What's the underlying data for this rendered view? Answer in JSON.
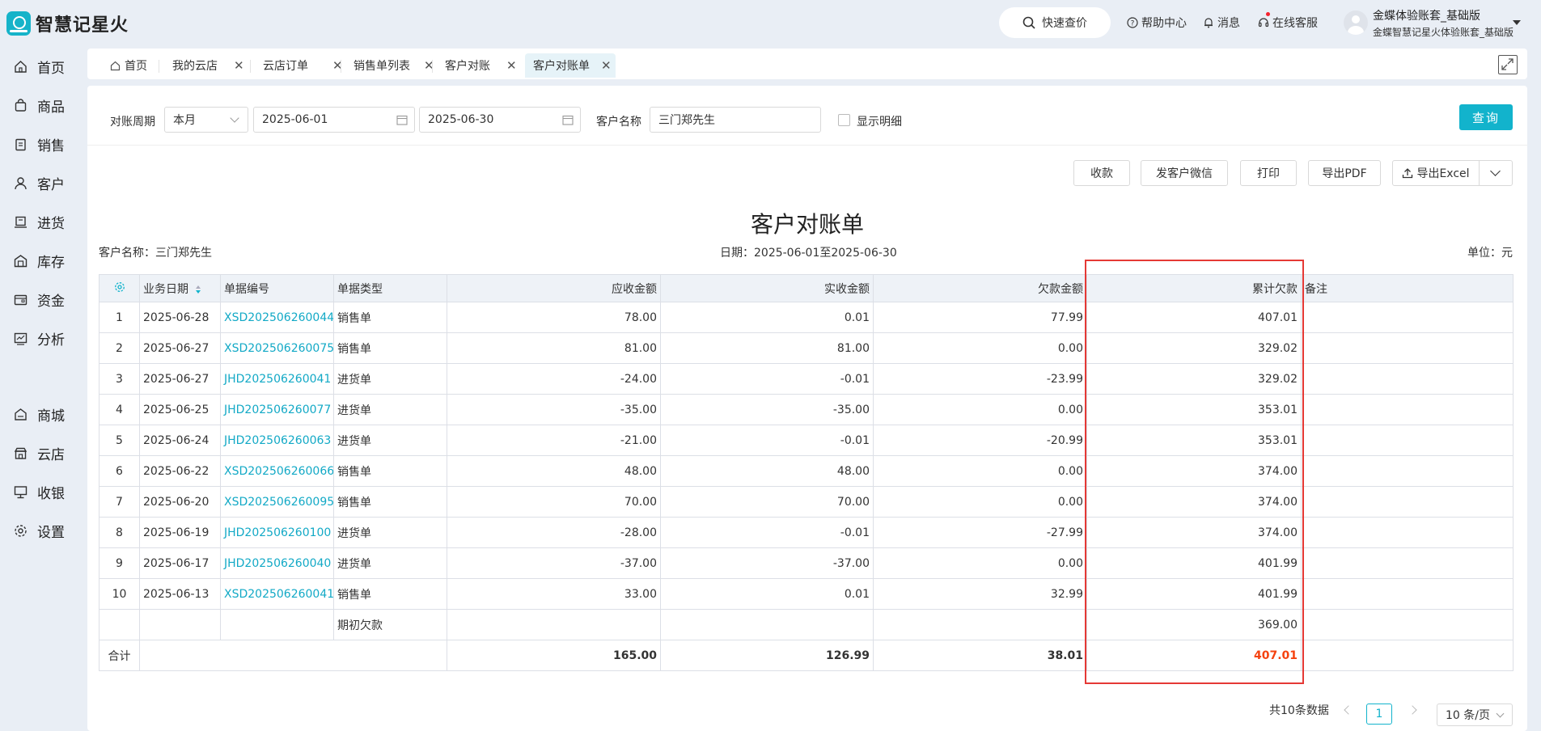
{
  "header": {
    "app_title": "智慧记星火",
    "quick_search": "快速查价",
    "help": "帮助中心",
    "messages": "消息",
    "support": "在线客服",
    "account_name": "金蝶体验账套_基础版",
    "account_sub": "金蝶智慧记星火体验账套_基础版"
  },
  "sidebar": {
    "items": [
      {
        "label": "首页",
        "icon": "home-icon"
      },
      {
        "label": "商品",
        "icon": "bag-icon"
      },
      {
        "label": "销售",
        "icon": "clipboard-icon"
      },
      {
        "label": "客户",
        "icon": "user-icon"
      },
      {
        "label": "进货",
        "icon": "truck-icon"
      },
      {
        "label": "库存",
        "icon": "warehouse-icon"
      },
      {
        "label": "资金",
        "icon": "wallet-icon"
      },
      {
        "label": "分析",
        "icon": "chart-icon"
      },
      {
        "label": "商城",
        "icon": "store-icon"
      },
      {
        "label": "云店",
        "icon": "cloud-store-icon"
      },
      {
        "label": "收银",
        "icon": "cashier-icon"
      },
      {
        "label": "设置",
        "icon": "gear-icon"
      }
    ]
  },
  "tabs": [
    {
      "label": "首页"
    },
    {
      "label": "我的云店"
    },
    {
      "label": "云店订单"
    },
    {
      "label": "销售单列表"
    },
    {
      "label": "客户对账"
    },
    {
      "label": "客户对账单"
    }
  ],
  "filter": {
    "period_label": "对账周期",
    "period_value": "本月",
    "start_date": "2025-06-01",
    "end_date": "2025-06-30",
    "customer_label": "客户名称",
    "customer_value": "三门郑先生",
    "show_detail": "显示明细",
    "query_button": "查询"
  },
  "actions": {
    "receive": "收款",
    "send_wechat": "发客户微信",
    "print": "打印",
    "export_pdf": "导出PDF",
    "export_excel": "导出Excel"
  },
  "report": {
    "title": "客户对账单",
    "customer_line": "客户名称：三门郑先生",
    "date_line": "日期：2025-06-01至2025-06-30",
    "unit_line": "单位：元"
  },
  "table": {
    "headers": {
      "date": "业务日期",
      "doc_no": "单据编号",
      "doc_type": "单据类型",
      "receivable": "应收金额",
      "received": "实收金额",
      "owed": "欠款金额",
      "cumulative": "累计欠款",
      "remark": "备注"
    },
    "rows": [
      {
        "no": "1",
        "date": "2025-06-28",
        "doc": "XSD202506260044",
        "type": "销售单",
        "receivable": "78.00",
        "received": "0.01",
        "owed": "77.99",
        "cumulative": "407.01"
      },
      {
        "no": "2",
        "date": "2025-06-27",
        "doc": "XSD202506260075",
        "type": "销售单",
        "receivable": "81.00",
        "received": "81.00",
        "owed": "0.00",
        "cumulative": "329.02"
      },
      {
        "no": "3",
        "date": "2025-06-27",
        "doc": "JHD202506260041",
        "type": "进货单",
        "receivable": "-24.00",
        "received": "-0.01",
        "owed": "-23.99",
        "cumulative": "329.02"
      },
      {
        "no": "4",
        "date": "2025-06-25",
        "doc": "JHD202506260077",
        "type": "进货单",
        "receivable": "-35.00",
        "received": "-35.00",
        "owed": "0.00",
        "cumulative": "353.01"
      },
      {
        "no": "5",
        "date": "2025-06-24",
        "doc": "JHD202506260063",
        "type": "进货单",
        "receivable": "-21.00",
        "received": "-0.01",
        "owed": "-20.99",
        "cumulative": "353.01"
      },
      {
        "no": "6",
        "date": "2025-06-22",
        "doc": "XSD202506260066",
        "type": "销售单",
        "receivable": "48.00",
        "received": "48.00",
        "owed": "0.00",
        "cumulative": "374.00"
      },
      {
        "no": "7",
        "date": "2025-06-20",
        "doc": "XSD202506260095",
        "type": "销售单",
        "receivable": "70.00",
        "received": "70.00",
        "owed": "0.00",
        "cumulative": "374.00"
      },
      {
        "no": "8",
        "date": "2025-06-19",
        "doc": "JHD202506260100",
        "type": "进货单",
        "receivable": "-28.00",
        "received": "-0.01",
        "owed": "-27.99",
        "cumulative": "374.00"
      },
      {
        "no": "9",
        "date": "2025-06-17",
        "doc": "JHD202506260040",
        "type": "进货单",
        "receivable": "-37.00",
        "received": "-37.00",
        "owed": "0.00",
        "cumulative": "401.99"
      },
      {
        "no": "10",
        "date": "2025-06-13",
        "doc": "XSD202506260041",
        "type": "销售单",
        "receivable": "33.00",
        "received": "0.01",
        "owed": "32.99",
        "cumulative": "401.99"
      }
    ],
    "opening": {
      "type": "期初欠款",
      "cumulative": "369.00"
    },
    "total": {
      "label": "合计",
      "receivable": "165.00",
      "received": "126.99",
      "owed": "38.01",
      "cumulative": "407.01"
    }
  },
  "pager": {
    "total_text": "共10条数据",
    "current_page": "1",
    "page_size": "10 条/页"
  },
  "colors": {
    "accent": "#12b3cc",
    "link": "#12a9c6",
    "total_red": "#f5420f",
    "highlight_red": "#e53935"
  }
}
